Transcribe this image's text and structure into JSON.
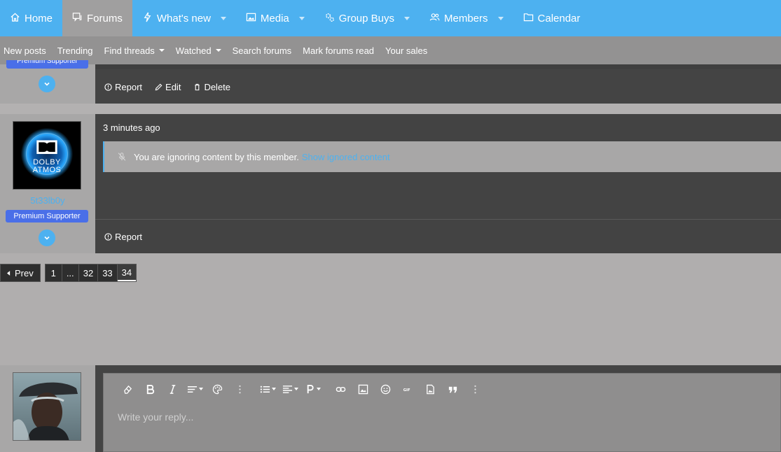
{
  "nav": {
    "tabs": [
      {
        "label": "Home",
        "icon": "home-icon",
        "dropdown": false
      },
      {
        "label": "Forums",
        "icon": "forums-icon",
        "dropdown": false,
        "active": true
      },
      {
        "label": "What's new",
        "icon": "bolt-icon",
        "dropdown": true
      },
      {
        "label": "Media",
        "icon": "image-icon",
        "dropdown": true
      },
      {
        "label": "Group Buys",
        "icon": "gears-icon",
        "dropdown": true
      },
      {
        "label": "Members",
        "icon": "users-icon",
        "dropdown": true
      },
      {
        "label": "Calendar",
        "icon": "folder-icon",
        "dropdown": false
      }
    ]
  },
  "subnav": {
    "items": [
      {
        "label": "New posts",
        "dropdown": false
      },
      {
        "label": "Trending",
        "dropdown": false
      },
      {
        "label": "Find threads",
        "dropdown": true
      },
      {
        "label": "Watched",
        "dropdown": true
      },
      {
        "label": "Search forums",
        "dropdown": false
      },
      {
        "label": "Mark forums read",
        "dropdown": false
      },
      {
        "label": "Your sales",
        "dropdown": false
      }
    ]
  },
  "post1": {
    "badge": "Premium Supporter",
    "actions": {
      "report": "Report",
      "edit": "Edit",
      "delete": "Delete"
    }
  },
  "post2": {
    "avatar_text_line1": "DOLBY",
    "avatar_text_line2": "ATMOS",
    "username": "5t33lb0y",
    "badge": "Premium Supporter",
    "date": "3 minutes ago",
    "ignored_message": "You are ignoring content by this member.",
    "ignored_link": "Show ignored content",
    "actions": {
      "report": "Report"
    }
  },
  "pagination": {
    "prev_label": "Prev",
    "pages": [
      "1",
      "...",
      "32",
      "33",
      "34"
    ],
    "current": "34"
  },
  "reply": {
    "placeholder": "Write your reply..."
  },
  "colors": {
    "accent": "#4db1f0",
    "badge": "#4a6fe8"
  }
}
